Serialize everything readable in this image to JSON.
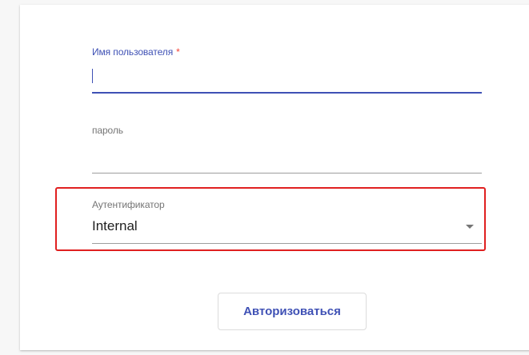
{
  "login_form": {
    "username": {
      "label": "Имя пользователя",
      "required_mark": "*",
      "value": ""
    },
    "password": {
      "label": "пароль",
      "value": ""
    },
    "authenticator": {
      "label": "Аутентификатор",
      "selected": "Internal",
      "icon": "dropdown-caret-icon"
    },
    "submit_label": "Авторизоваться"
  },
  "colors": {
    "accent": "#3f51b5",
    "required": "#f44336",
    "highlight": "#e02020",
    "label": "#757575",
    "text": "#212121"
  }
}
